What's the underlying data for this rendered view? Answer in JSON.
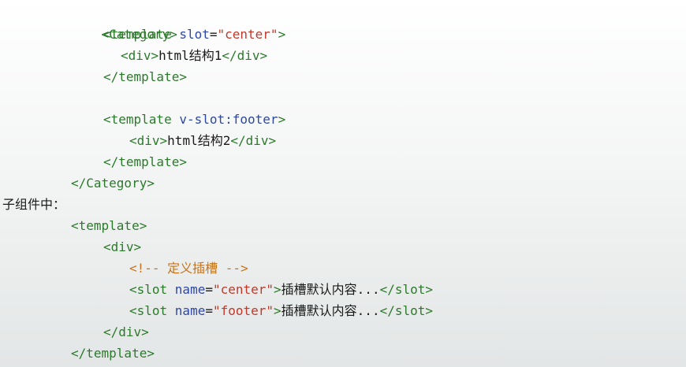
{
  "parent_code": {
    "l1": {
      "tag": "<Category>"
    },
    "l2": {
      "tag_open": "<template ",
      "attr": "slot",
      "eq": "=",
      "val": "\"center\"",
      "tag_close": ">"
    },
    "l3": {
      "tag_open": "<div>",
      "text": "html结构1",
      "tag_close": "</div>"
    },
    "l4": {
      "tag": "</template>"
    },
    "l5": {
      "tag_open": "<template ",
      "attr": "v-slot:footer",
      "tag_close": ">"
    },
    "l6": {
      "tag_open": "<div>",
      "text": "html结构2",
      "tag_close": "</div>"
    },
    "l7": {
      "tag": "</template>"
    },
    "l8": {
      "tag": "</Category>"
    }
  },
  "child_label": "子组件中：",
  "child_code": {
    "l1": {
      "tag": "<template>"
    },
    "l2": {
      "tag": "<div>"
    },
    "l3": {
      "comment": "<!-- 定义插槽 -->"
    },
    "l4": {
      "tag_open": "<slot ",
      "attr": "name",
      "eq": "=",
      "val": "\"center\"",
      "tag_gt": ">",
      "text": "插槽默认内容...",
      "tag_close": "</slot>"
    },
    "l5": {
      "tag_open": "<slot ",
      "attr": "name",
      "eq": "=",
      "val": "\"footer\"",
      "tag_gt": ">",
      "text": "插槽默认内容...",
      "tag_close": "</slot>"
    },
    "l6": {
      "tag": "</div>"
    },
    "l7": {
      "tag": "</template>"
    }
  }
}
